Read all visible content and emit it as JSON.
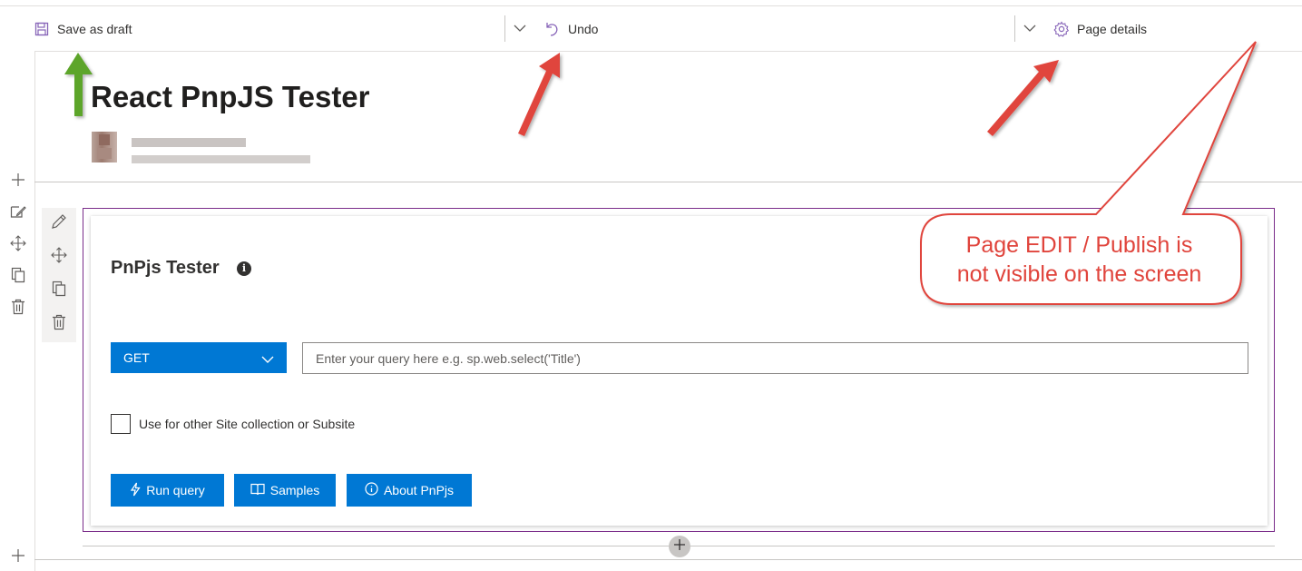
{
  "toolbar": {
    "save_label": "Save as draft",
    "undo_label": "Undo",
    "page_details_label": "Page details"
  },
  "page": {
    "title": "React PnpJS Tester"
  },
  "webpart": {
    "title": "PnPjs Tester",
    "info_glyph": "i",
    "method_selected": "GET",
    "query_placeholder": "Enter your query here e.g. sp.web.select('Title')",
    "checkbox_label": "Use for other Site collection or Subsite",
    "buttons": {
      "run": "Run query",
      "samples": "Samples",
      "about": "About PnPjs"
    }
  },
  "callout": {
    "line1": "Page EDIT / Publish is",
    "line2": "not visible on the screen"
  },
  "colors": {
    "accent": "#0078d4",
    "section_border": "#7a2c8a",
    "annotation_red": "#e0443c",
    "annotation_green": "#5da52b"
  },
  "icons": [
    "save-icon",
    "undo-icon",
    "gear-icon",
    "chevron-down-icon",
    "plus-icon",
    "edit-icon",
    "move-icon",
    "duplicate-icon",
    "delete-icon",
    "info-icon",
    "lightning-icon",
    "book-icon"
  ]
}
